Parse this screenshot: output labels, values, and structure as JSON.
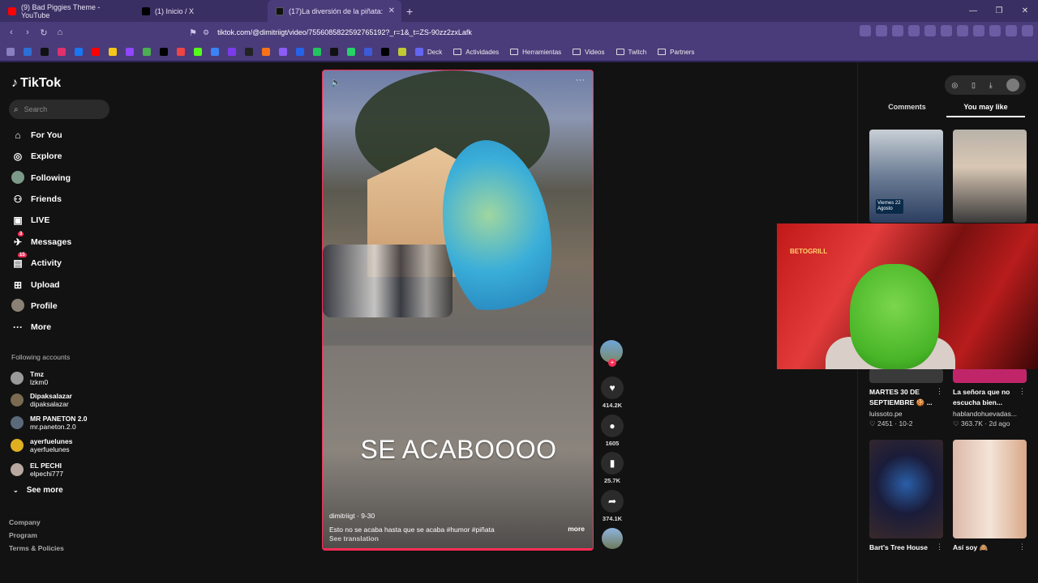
{
  "browser": {
    "tabs": [
      {
        "label": "(9) Bad Piggies Theme - YouTube",
        "color": "#ff0000"
      },
      {
        "label": "(1) Inicio / X",
        "color": "#000000"
      },
      {
        "label": "(17)La diversión de la piñata:",
        "color": "#111111",
        "active": true
      }
    ],
    "new_tab": "+",
    "url": "tiktok.com/@dimitriigt/video/7556085822592765192?_r=1&_t=ZS-90zz2zxLafk",
    "bookmarks": [
      {
        "label": "Deck"
      },
      {
        "label": "Actividades"
      },
      {
        "label": "Herramientas"
      },
      {
        "label": "Videos"
      },
      {
        "label": "Twitch"
      },
      {
        "label": "Partners"
      }
    ]
  },
  "tiktok": {
    "logo": "TikTok",
    "search_placeholder": "Search",
    "menu": [
      {
        "label": "For You",
        "icon": "home-icon"
      },
      {
        "label": "Explore",
        "icon": "compass-icon"
      },
      {
        "label": "Following",
        "icon": "following-avatar-icon"
      },
      {
        "label": "Friends",
        "icon": "friends-icon"
      },
      {
        "label": "LIVE",
        "icon": "live-icon"
      },
      {
        "label": "Messages",
        "icon": "messages-icon",
        "badge": "3"
      },
      {
        "label": "Activity",
        "icon": "activity-icon",
        "badge": "15"
      },
      {
        "label": "Upload",
        "icon": "upload-icon"
      },
      {
        "label": "Profile",
        "icon": "profile-avatar-icon"
      },
      {
        "label": "More",
        "icon": "more-icon"
      }
    ],
    "following_title": "Following accounts",
    "following": [
      {
        "name": "Tmz",
        "user": "lzkm0"
      },
      {
        "name": "Dipaksalazar",
        "user": "dipaksalazar"
      },
      {
        "name": "MR PANETON 2.0",
        "user": "mr.paneton.2.0"
      },
      {
        "name": "ayerfuelunes",
        "user": "ayerfuelunes"
      },
      {
        "name": "EL PECHI",
        "user": "elpechi777"
      }
    ],
    "see_more": "See more",
    "footer": [
      "Company",
      "Program",
      "Terms & Policies"
    ]
  },
  "video": {
    "overlay_text": "SE ACABOOOO",
    "author_date": "dimitriigt · 9-30",
    "description": "Esto no se acaba hasta que se acaba #humor  #piñata",
    "see_translation": "See translation",
    "more": "more",
    "likes": "414.2K",
    "comments": "1605",
    "saves": "25.7K",
    "shares": "374.1K"
  },
  "right_panel": {
    "tabs": [
      "Comments",
      "You may like"
    ],
    "active_tab": "You may like",
    "cards": [
      {
        "title": "MARTES 30 DE SEPTIEMBRE 🍪 ...",
        "user": "luissoto.pe",
        "stats": "♡ 2451 · 10-2"
      },
      {
        "title": "La señora que no escucha bien...",
        "user": "hablandohuevadas...",
        "stats": "♡ 363.7K · 2d ago"
      },
      {
        "title": "Bart's Tree House",
        "user": "",
        "stats": ""
      },
      {
        "title": "Así soy 🙈",
        "user": "",
        "stats": ""
      }
    ],
    "thumb_text_1": "Viernes 22 Agosto"
  },
  "webcam": {
    "overlay_text": "BETOGRILL"
  }
}
